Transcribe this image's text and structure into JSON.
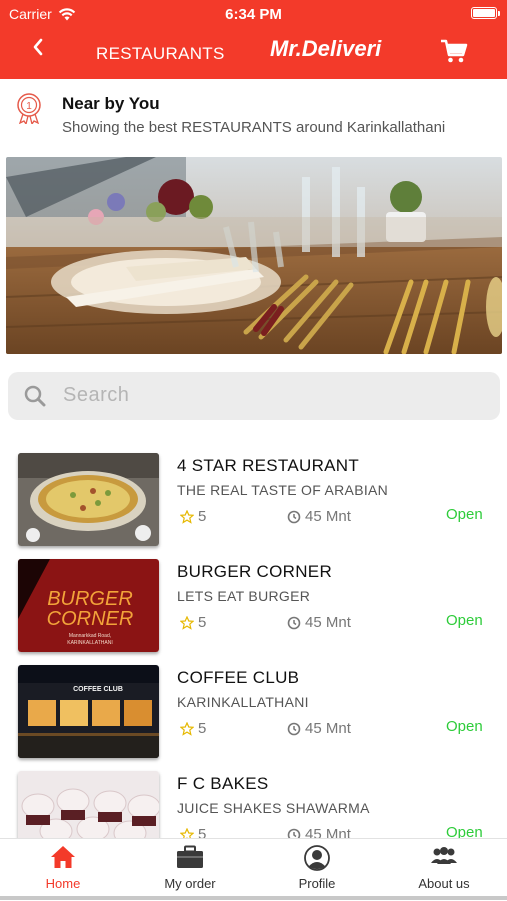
{
  "status_bar": {
    "carrier": "Carrier",
    "time": "6:34 PM"
  },
  "nav": {
    "back_icon": "chevron-left-icon",
    "title": "RESTAURANTS",
    "logo_text": "Mr.Deliveri",
    "cart_icon": "cart-icon"
  },
  "nearby": {
    "title": "Near by You",
    "subtitle": "Showing the best RESTAURANTS around Karinkallathani"
  },
  "search": {
    "placeholder": "Search"
  },
  "restaurants": [
    {
      "name": "4 STAR RESTAURANT",
      "tagline": "THE REAL TASTE OF ARABIAN",
      "rating": "5",
      "time": "45 Mnt",
      "status": "Open"
    },
    {
      "name": "BURGER CORNER",
      "tagline": "LETS EAT BURGER",
      "rating": "5",
      "time": "45 Mnt",
      "status": "Open",
      "thumb_text": "BURGER CORNER",
      "thumb_address_1": "Mannarkkad Road,",
      "thumb_address_2": "KARINKALLATHANI"
    },
    {
      "name": "COFFEE CLUB",
      "tagline": "KARINKALLATHANI",
      "rating": "5",
      "time": "45 Mnt",
      "status": "Open",
      "thumb_text": "COFFEE CLUB"
    },
    {
      "name": "F C BAKES",
      "tagline": "JUICE SHAKES SHAWARMA",
      "rating": "5",
      "time": "45 Mnt",
      "status": "Open"
    }
  ],
  "tabs": [
    {
      "label": "Home",
      "icon": "home-icon",
      "active": true
    },
    {
      "label": "My order",
      "icon": "briefcase-icon",
      "active": false
    },
    {
      "label": "Profile",
      "icon": "profile-icon",
      "active": false
    },
    {
      "label": "About us",
      "icon": "group-icon",
      "active": false
    }
  ],
  "colors": {
    "primary": "#f33a2a",
    "open_status": "#2ecc3a",
    "search_bg": "#ececec"
  }
}
